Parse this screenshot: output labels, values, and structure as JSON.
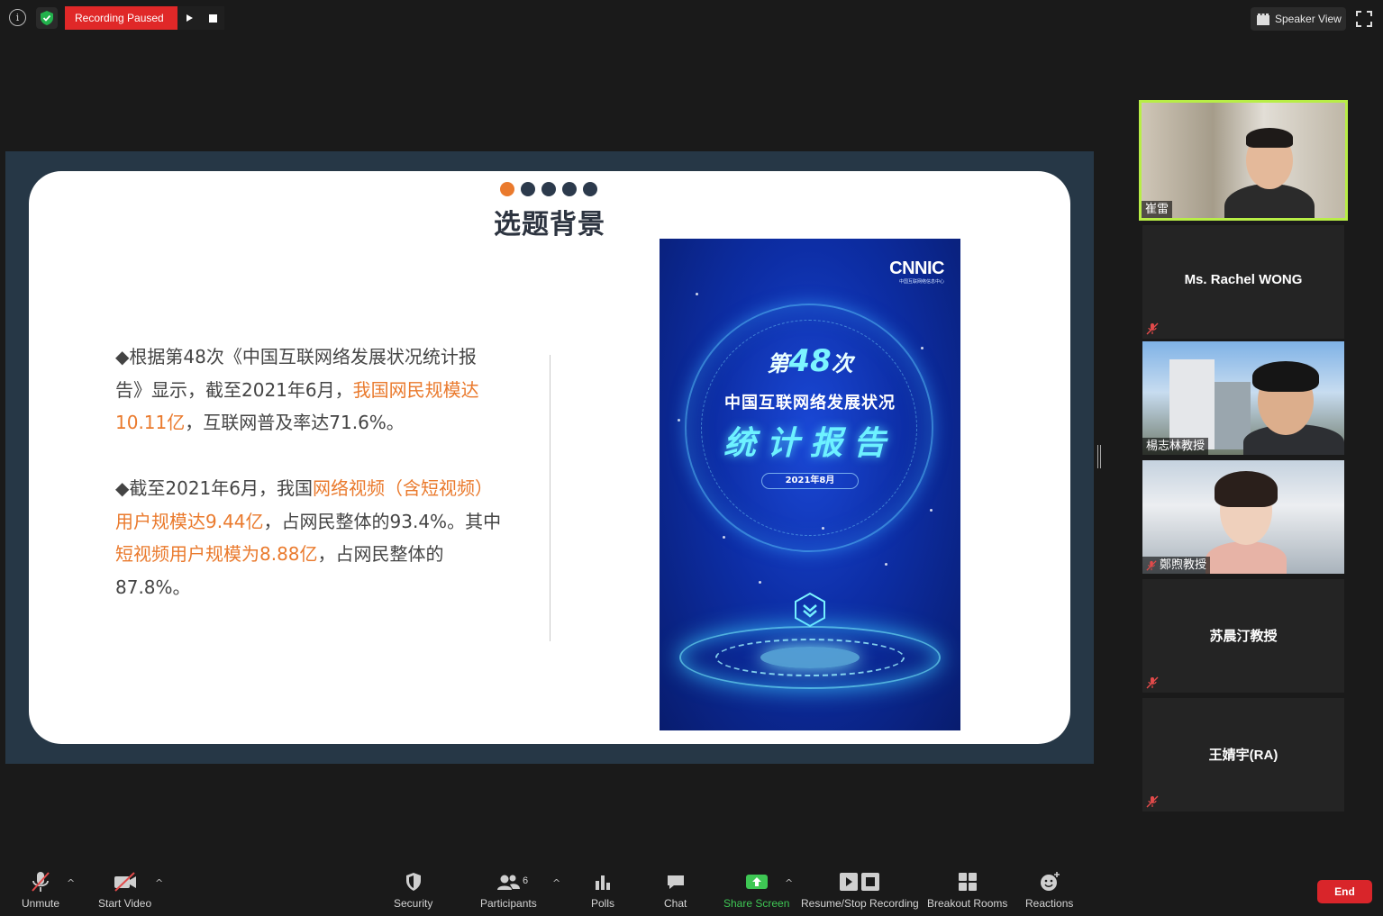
{
  "top_bar": {
    "info_icon": "info-icon",
    "security_badge_icon": "shield-check-icon",
    "recording_status": "Recording Paused",
    "resume_icon": "play-icon",
    "stop_icon": "stop-icon",
    "view_label": "Speaker View",
    "fullscreen_icon": "fullscreen-icon"
  },
  "slide": {
    "title": "选题背景",
    "dots_total": 5,
    "dots_active": 1,
    "bullet1": {
      "p1": "◆根据第48次《中国互联网络发展状况统计报告》显示，截至2021年6月，",
      "hl1": "我国网民规模达10.11亿",
      "p2": "，互联网普及率达71.6%。"
    },
    "bullet2": {
      "p1": "◆截至2021年6月，我国",
      "hl1": "网络视频（含短视频）用户规模达9.44亿",
      "p2": "，占网民整体的93.4%。其中",
      "hl2": "短视频用户规模为8.88亿",
      "p3": "，占网民整体的87.8%。"
    },
    "cover": {
      "logo": "CNNIC",
      "logo_sub": "中国互联网络信息中心",
      "edition_prefix": "第",
      "edition_number": "48",
      "edition_suffix": "次",
      "subtitle": "中国互联网络发展状况",
      "main_title": "统计报告",
      "date": "2021年8月"
    }
  },
  "participants": [
    {
      "name": "崔雷",
      "video": true,
      "muted": false,
      "active_speaker": true
    },
    {
      "name": "Ms. Rachel WONG",
      "video": false,
      "muted": true
    },
    {
      "name": "楊志林教授",
      "video": true,
      "muted": false
    },
    {
      "name": "鄭煦教授",
      "video": true,
      "muted": true
    },
    {
      "name": "苏晨汀教授",
      "video": false,
      "muted": true
    },
    {
      "name": "王婧宇(RA)",
      "video": false,
      "muted": true
    }
  ],
  "toolbar": {
    "unmute": "Unmute",
    "start_video": "Start Video",
    "security": "Security",
    "participants": "Participants",
    "participants_count": "6",
    "polls": "Polls",
    "chat": "Chat",
    "share_screen": "Share Screen",
    "recording": "Resume/Stop Recording",
    "breakout": "Breakout Rooms",
    "reactions": "Reactions",
    "end": "End"
  },
  "colors": {
    "recording_red": "#e02828",
    "accent_orange": "#ea7a2d",
    "share_green": "#3ec754",
    "active_speaker_border": "#b8ee46",
    "end_red": "#d9252a"
  }
}
